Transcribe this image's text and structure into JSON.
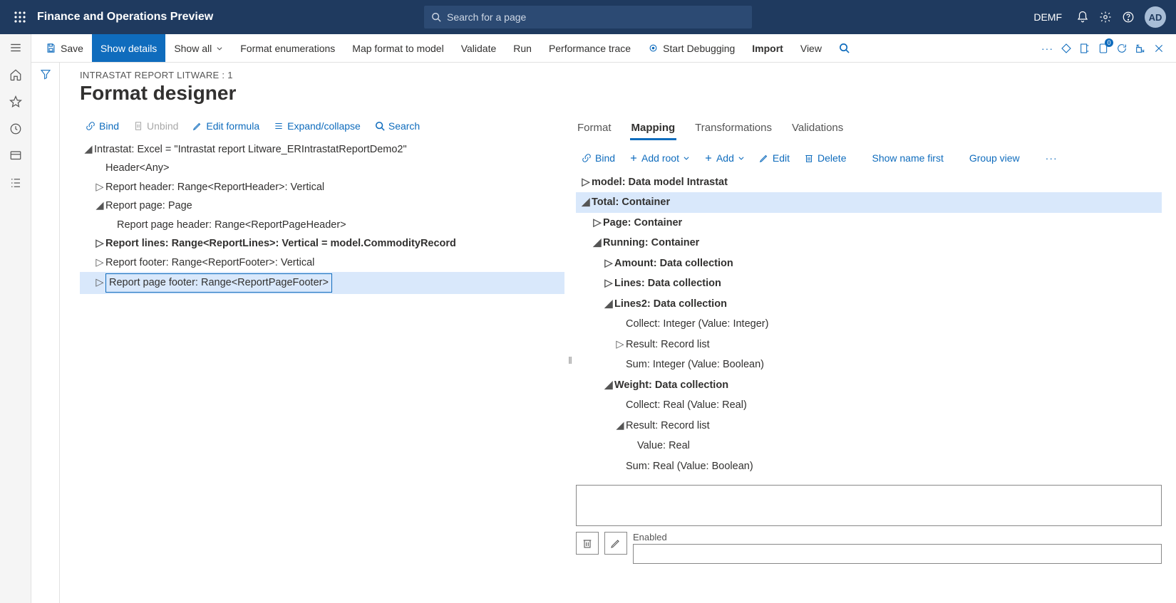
{
  "topbar": {
    "product": "Finance and Operations Preview",
    "search_placeholder": "Search for a page",
    "company": "DEMF",
    "avatar": "AD"
  },
  "actionbar": {
    "save": "Save",
    "show_details": "Show details",
    "show_all": "Show all",
    "format_enum": "Format enumerations",
    "map_format": "Map format to model",
    "validate": "Validate",
    "run": "Run",
    "perf_trace": "Performance trace",
    "start_debug": "Start Debugging",
    "import": "Import",
    "view": "View",
    "badge_count": "0"
  },
  "page": {
    "breadcrumb": "INTRASTAT REPORT LITWARE : 1",
    "title": "Format designer"
  },
  "left_toolbar": {
    "bind": "Bind",
    "unbind": "Unbind",
    "edit_formula": "Edit formula",
    "expand": "Expand/collapse",
    "search": "Search"
  },
  "left_tree": {
    "n0": "Intrastat: Excel = \"Intrastat report Litware_ERIntrastatReportDemo2\"",
    "n1": "Header<Any>",
    "n2": "Report header: Range<ReportHeader>: Vertical",
    "n3": "Report page: Page",
    "n4": "Report page header: Range<ReportPageHeader>",
    "n5": "Report lines: Range<ReportLines>: Vertical = model.CommodityRecord",
    "n6": "Report footer: Range<ReportFooter>: Vertical",
    "n7": "Report page footer: Range<ReportPageFooter>"
  },
  "tabs": {
    "format": "Format",
    "mapping": "Mapping",
    "transformations": "Transformations",
    "validations": "Validations"
  },
  "right_toolbar": {
    "bind": "Bind",
    "add_root": "Add root",
    "add": "Add",
    "edit": "Edit",
    "delete": "Delete",
    "show_name_first": "Show name first",
    "group_view": "Group view"
  },
  "right_tree": {
    "r0": "model: Data model Intrastat",
    "r1": "Total: Container",
    "r2": "Page: Container",
    "r3": "Running: Container",
    "r4": "Amount: Data collection",
    "r5": "Lines: Data collection",
    "r6": "Lines2: Data collection",
    "r7": "Collect: Integer (Value: Integer)",
    "r8": "Result: Record list",
    "r9": "Sum: Integer (Value: Boolean)",
    "r10": "Weight: Data collection",
    "r11": "Collect: Real (Value: Real)",
    "r12": "Result: Record list",
    "r13": "Value: Real",
    "r14": "Sum: Real (Value: Boolean)"
  },
  "bottom": {
    "enabled_label": "Enabled"
  }
}
